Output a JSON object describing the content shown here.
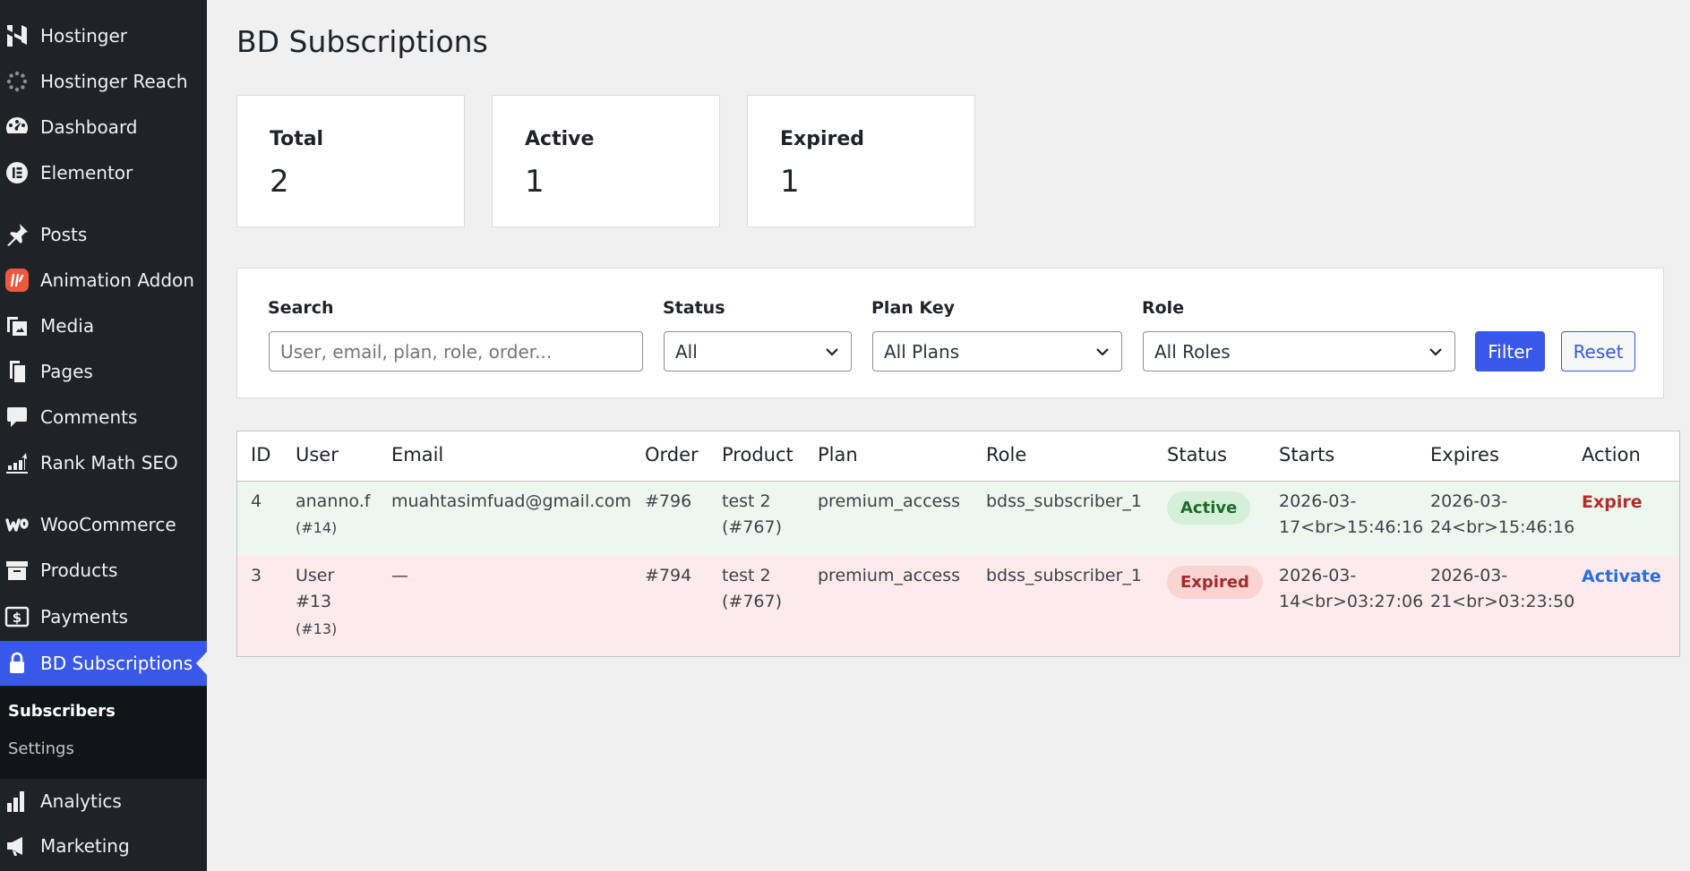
{
  "sidebar": {
    "items": [
      {
        "label": "Hostinger",
        "icon": "hostinger-icon"
      },
      {
        "label": "Hostinger Reach",
        "icon": "spinner-icon"
      },
      {
        "label": "Dashboard",
        "icon": "dashboard-icon"
      },
      {
        "label": "Elementor",
        "icon": "elementor-icon"
      },
      {
        "label": "Posts",
        "icon": "pin-icon"
      },
      {
        "label": "Animation Addon",
        "icon": "animation-addon-icon"
      },
      {
        "label": "Media",
        "icon": "media-icon"
      },
      {
        "label": "Pages",
        "icon": "pages-icon"
      },
      {
        "label": "Comments",
        "icon": "comment-icon"
      },
      {
        "label": "Rank Math SEO",
        "icon": "rank-math-icon"
      },
      {
        "label": "WooCommerce",
        "icon": "woocommerce-icon"
      },
      {
        "label": "Products",
        "icon": "archive-icon"
      },
      {
        "label": "Payments",
        "icon": "dollar-icon"
      },
      {
        "label": "BD Subscriptions",
        "icon": "lock-icon"
      },
      {
        "label": "Analytics",
        "icon": "bar-chart-icon"
      },
      {
        "label": "Marketing",
        "icon": "megaphone-icon"
      }
    ],
    "submenu": [
      {
        "label": "Subscribers"
      },
      {
        "label": "Settings"
      }
    ]
  },
  "page": {
    "title": "BD Subscriptions"
  },
  "stats": [
    {
      "label": "Total",
      "value": "2"
    },
    {
      "label": "Active",
      "value": "1"
    },
    {
      "label": "Expired",
      "value": "1"
    }
  ],
  "filters": {
    "search_label": "Search",
    "search_placeholder": "User, email, plan, role, order...",
    "status_label": "Status",
    "status_value": "All",
    "plan_label": "Plan Key",
    "plan_value": "All Plans",
    "role_label": "Role",
    "role_value": "All Roles",
    "filter_button": "Filter",
    "reset_button": "Reset"
  },
  "table": {
    "columns": [
      "ID",
      "User",
      "Email",
      "Order",
      "Product",
      "Plan",
      "Role",
      "Status",
      "Starts",
      "Expires",
      "Action"
    ],
    "rows": [
      {
        "id": "4",
        "user": "ananno.f",
        "user_id": "(#14)",
        "email": "muahtasimfuad@gmail.com",
        "order": "#796",
        "product_1": "test 2",
        "product_2": "(#767)",
        "plan": "premium_access",
        "role": "bdss_subscriber_1",
        "status": "Active",
        "starts_1": "2026-03-",
        "starts_2": "17<br>15:46:16",
        "expires_1": "2026-03-",
        "expires_2": "24<br>15:46:16",
        "action": "Expire"
      },
      {
        "id": "3",
        "user_1": "User",
        "user_2": "#13",
        "user_id": "(#13)",
        "email": "—",
        "order": "#794",
        "product_1": "test 2",
        "product_2": "(#767)",
        "plan": "premium_access",
        "role": "bdss_subscriber_1",
        "status": "Expired",
        "starts_1": "2026-03-",
        "starts_2": "14<br>03:27:06",
        "expires_1": "2026-03-",
        "expires_2": "21<br>03:23:50",
        "action": "Activate"
      }
    ]
  },
  "colors": {
    "sidebar_bg": "#1d2327",
    "accent": "#3858e9",
    "active_row": "#edf7ee",
    "expired_row": "#fcebea"
  }
}
